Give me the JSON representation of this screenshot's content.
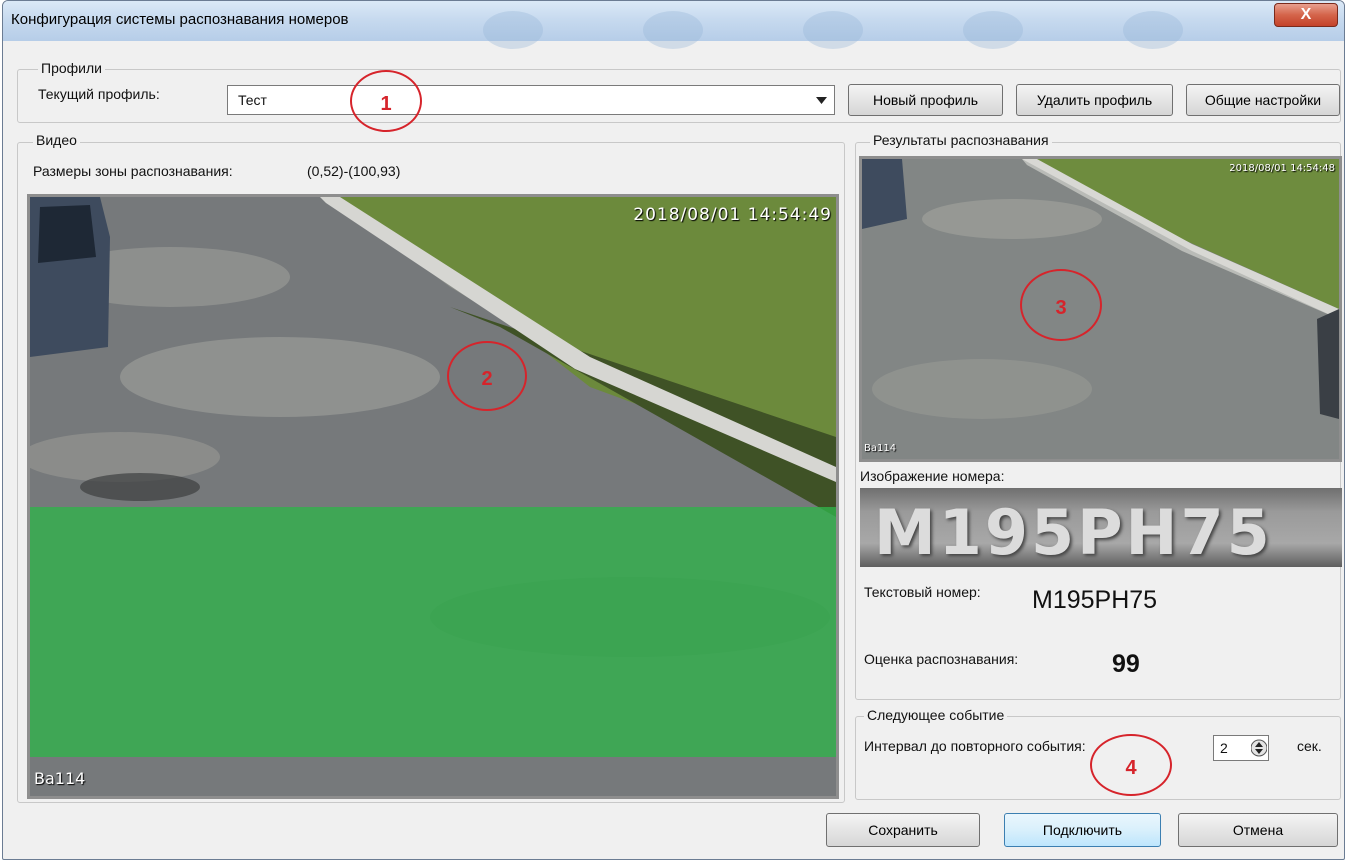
{
  "window": {
    "title": "Конфигурация системы распознавания номеров",
    "close_glyph": "X"
  },
  "profiles": {
    "group_label": "Профили",
    "current_label": "Текущий профиль:",
    "current_value": "Тест",
    "new_button": "Новый профиль",
    "delete_button": "Удалить профиль",
    "settings_button": "Общие настройки"
  },
  "video": {
    "group_label": "Видео",
    "zone_label": "Размеры зоны распознавания:",
    "zone_value": "(0,52)-(100,93)",
    "timestamp": "2018/08/01 14:54:49",
    "camera_tag": "Ba114"
  },
  "results": {
    "group_label": "Результаты распознавания",
    "snapshot_timestamp": "2018/08/01 14:54:48",
    "snapshot_tag": "Ba114",
    "plate_image_label": "Изображение номера:",
    "plate_image_text": "M195PH75",
    "text_number_label": "Текстовый номер:",
    "text_number_value": "M195PH75",
    "score_label": "Оценка распознавания:",
    "score_value": "99"
  },
  "next_event": {
    "group_label": "Следующее событие",
    "interval_label": "Интервал до повторного события:",
    "interval_value": "2",
    "unit": "сек."
  },
  "footer": {
    "save_button": "Сохранить",
    "connect_button": "Подключить",
    "cancel_button": "Отмена"
  },
  "annotations": {
    "marker_1": "1",
    "marker_2": "2",
    "marker_3": "3",
    "marker_4": "4",
    "color": "#d6242b"
  },
  "recognition_zone": {
    "from_percent": [
      0,
      52
    ],
    "to_percent": [
      100,
      93
    ],
    "color": "#2fb34a"
  }
}
